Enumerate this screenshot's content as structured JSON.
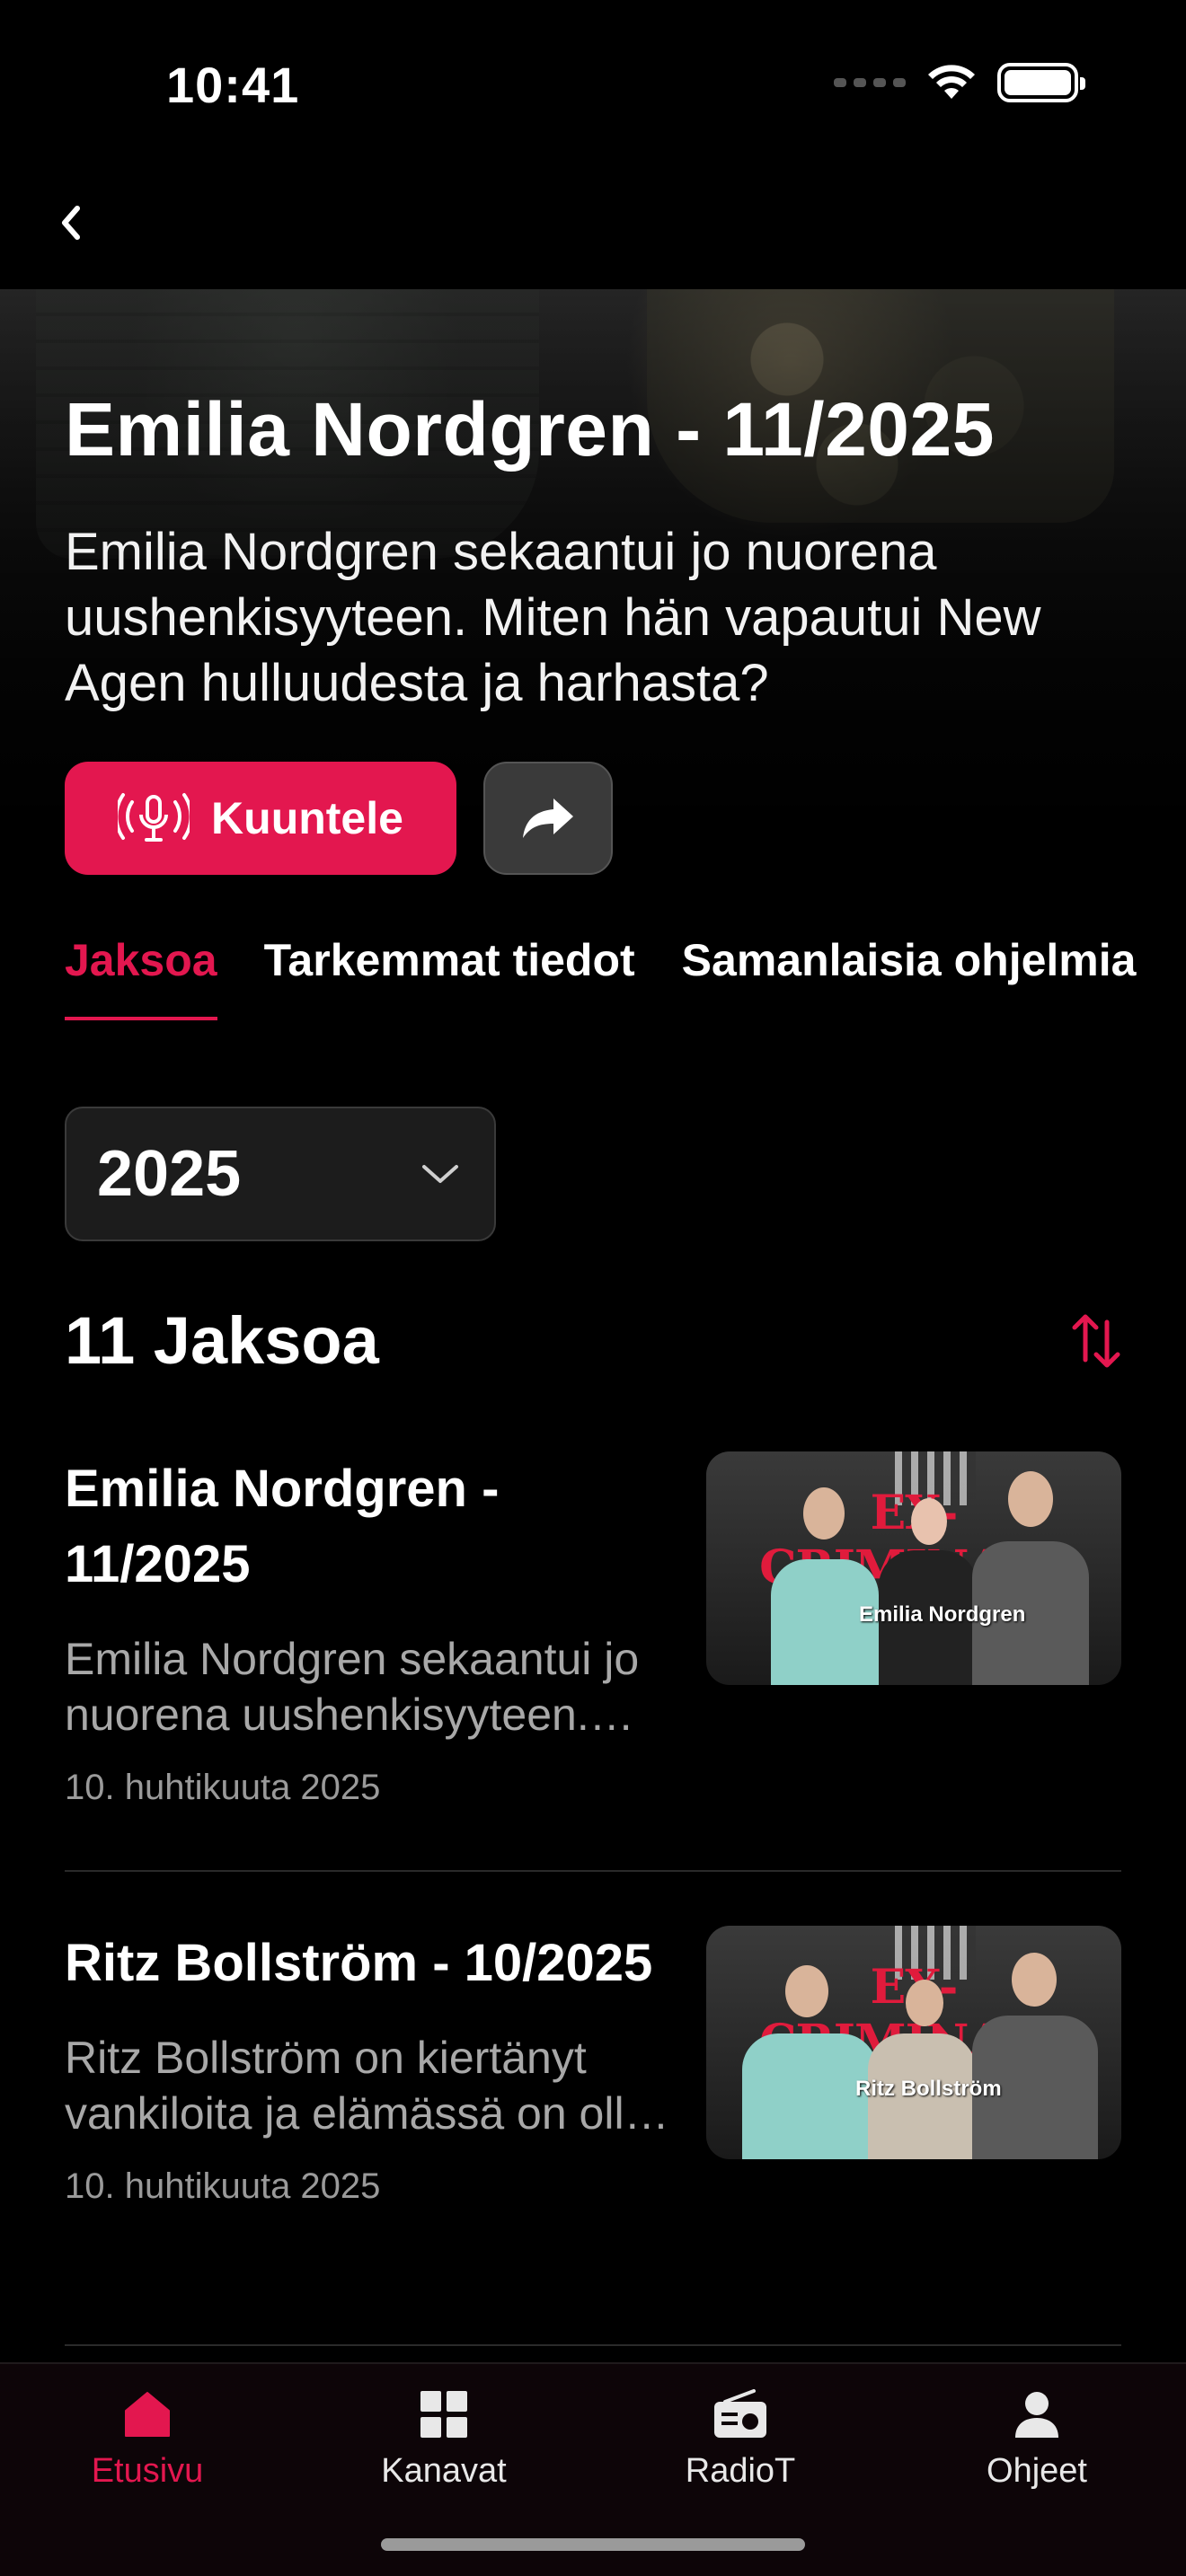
{
  "status_bar": {
    "time": "10:41"
  },
  "hero": {
    "title": "Emilia Nordgren - 11/2025",
    "description": "Emilia Nordgren sekaantui jo nuorena uushenkisyyteen. Miten hän vapautui New Agen hulluudesta ja harhasta?",
    "listen_label": "Kuuntele"
  },
  "tabs": [
    {
      "label": "Jaksoa"
    },
    {
      "label": "Tarkemmat tiedot"
    },
    {
      "label": "Samanlaisia ohjelmia"
    }
  ],
  "season": {
    "selected": "2025"
  },
  "episodes_header": {
    "count_label": "11 Jaksoa"
  },
  "episodes": [
    {
      "title": "Emilia Nordgren - 11/2025",
      "description": "Emilia Nordgren sekaantui jo nuorena uushenkisyyteen. Miten hän vapautui New Agen hulluudesta ja harhasta?",
      "date": "10. huhtikuuta 2025",
      "thumb_banner": "EX-CRIMINALS",
      "thumb_name": "Emilia Nordgren"
    },
    {
      "title": "Ritz Bollström - 10/2025",
      "description": "Ritz Bollström on kiertänyt vankiloita ja elämässä on ollut paljon vaikeuksia.",
      "date": "10. huhtikuuta 2025",
      "thumb_banner": "EX-CRIMINALS",
      "thumb_name": "Ritz Bollström"
    }
  ],
  "bottom_nav": [
    {
      "label": "Etusivu",
      "icon": "home-icon"
    },
    {
      "label": "Kanavat",
      "icon": "grid-icon"
    },
    {
      "label": "RadioT",
      "icon": "radio-icon"
    },
    {
      "label": "Ohjeet",
      "icon": "user-icon"
    }
  ],
  "colors": {
    "accent": "#e3174f",
    "background": "#000000",
    "surface": "#1c1c1c"
  }
}
